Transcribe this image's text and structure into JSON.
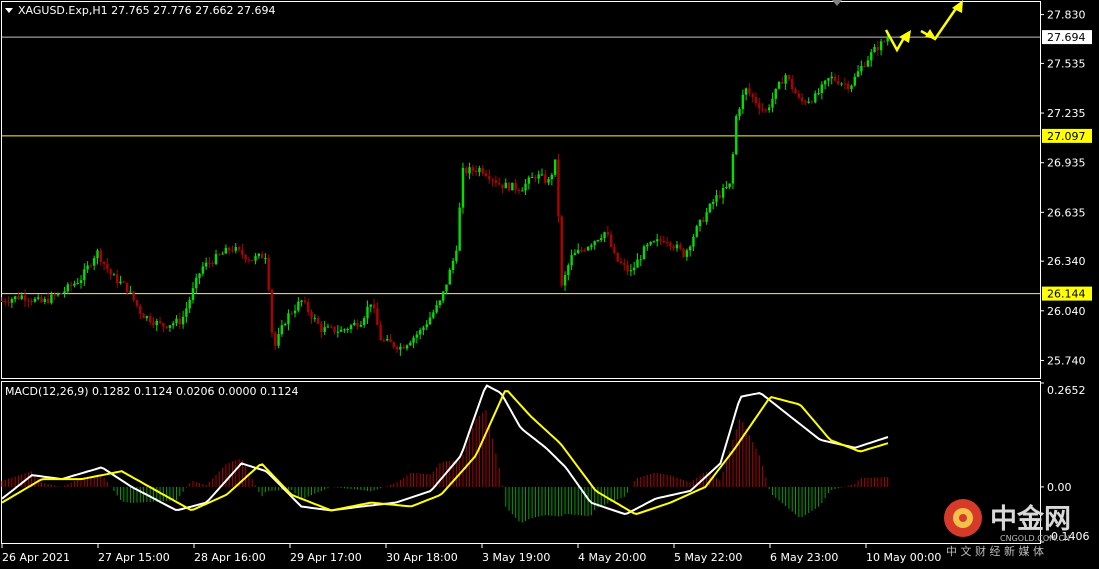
{
  "colors": {
    "background": "#000000",
    "bull": "#00e000",
    "bear": "#b00000",
    "level_line": "#ffff00",
    "last_price_line": "#c0c0c0",
    "macd_line": "#ffffff",
    "signal_line": "#ffff00",
    "hist_pos": "#b00000",
    "hist_neg": "#00a000",
    "arrow": "#ffff00",
    "frame": "#ffffff",
    "watermark_red": "#d83a2a"
  },
  "price_header": "XAGUSD.Exp,H1  27.765 27.776 27.662 27.694",
  "macd_header": "MACD(12,26,9) 0.1282 0.1124 0.0206 0.0000 0.1124",
  "price_ticks": [
    "27.830",
    "27.535",
    "27.235",
    "26.935",
    "26.635",
    "26.340",
    "26.040",
    "25.740"
  ],
  "macd_ticks": [
    "0.2652",
    "0.00",
    "-0.1406"
  ],
  "time_ticks": [
    "26 Apr 2021",
    "27 Apr 15:00",
    "28 Apr 16:00",
    "29 Apr 17:00",
    "30 Apr 18:00",
    "3 May 19:00",
    "4 May 20:00",
    "5 May 22:00",
    "6 May 23:00",
    "10 May 00:00"
  ],
  "levels": [
    {
      "value": 27.694,
      "label": "27.694",
      "kind": "last"
    },
    {
      "value": 27.097,
      "label": "27.097",
      "kind": "level"
    },
    {
      "value": 26.144,
      "label": "26.144",
      "kind": "level"
    }
  ],
  "watermark": {
    "brand": "中金网",
    "site": "CNGOLD.COM.CN",
    "tagline": "中 文 财 经 新 媒 体"
  },
  "chart_data": {
    "type": "candlestick",
    "symbol": "XAGUSD.Exp",
    "timeframe": "H1",
    "ohlc": {
      "open": 27.765,
      "high": 27.776,
      "low": 27.662,
      "close": 27.694
    },
    "ylim": [
      25.64,
      27.9
    ],
    "close_path": [
      {
        "x": 0,
        "y": 26.1
      },
      {
        "x": 20,
        "y": 26.13
      },
      {
        "x": 40,
        "y": 26.09
      },
      {
        "x": 60,
        "y": 26.15
      },
      {
        "x": 80,
        "y": 26.24
      },
      {
        "x": 95,
        "y": 26.4
      },
      {
        "x": 110,
        "y": 26.25
      },
      {
        "x": 125,
        "y": 26.18
      },
      {
        "x": 140,
        "y": 26.02
      },
      {
        "x": 160,
        "y": 25.95
      },
      {
        "x": 180,
        "y": 25.98
      },
      {
        "x": 200,
        "y": 26.3
      },
      {
        "x": 215,
        "y": 26.36
      },
      {
        "x": 230,
        "y": 26.42
      },
      {
        "x": 250,
        "y": 26.35
      },
      {
        "x": 265,
        "y": 26.38
      },
      {
        "x": 272,
        "y": 25.8
      },
      {
        "x": 285,
        "y": 26.0
      },
      {
        "x": 300,
        "y": 26.1
      },
      {
        "x": 320,
        "y": 25.93
      },
      {
        "x": 340,
        "y": 25.92
      },
      {
        "x": 360,
        "y": 25.98
      },
      {
        "x": 370,
        "y": 26.1
      },
      {
        "x": 380,
        "y": 25.86
      },
      {
        "x": 400,
        "y": 25.82
      },
      {
        "x": 420,
        "y": 25.92
      },
      {
        "x": 440,
        "y": 26.1
      },
      {
        "x": 455,
        "y": 26.4
      },
      {
        "x": 462,
        "y": 26.88
      },
      {
        "x": 480,
        "y": 26.9
      },
      {
        "x": 500,
        "y": 26.8
      },
      {
        "x": 520,
        "y": 26.78
      },
      {
        "x": 535,
        "y": 26.86
      },
      {
        "x": 548,
        "y": 26.82
      },
      {
        "x": 556,
        "y": 26.96
      },
      {
        "x": 560,
        "y": 26.16
      },
      {
        "x": 570,
        "y": 26.36
      },
      {
        "x": 590,
        "y": 26.45
      },
      {
        "x": 605,
        "y": 26.52
      },
      {
        "x": 615,
        "y": 26.35
      },
      {
        "x": 630,
        "y": 26.27
      },
      {
        "x": 645,
        "y": 26.42
      },
      {
        "x": 665,
        "y": 26.48
      },
      {
        "x": 684,
        "y": 26.38
      },
      {
        "x": 695,
        "y": 26.52
      },
      {
        "x": 715,
        "y": 26.72
      },
      {
        "x": 730,
        "y": 26.8
      },
      {
        "x": 736,
        "y": 27.22
      },
      {
        "x": 745,
        "y": 27.38
      },
      {
        "x": 765,
        "y": 27.24
      },
      {
        "x": 785,
        "y": 27.47
      },
      {
        "x": 800,
        "y": 27.3
      },
      {
        "x": 815,
        "y": 27.33
      },
      {
        "x": 830,
        "y": 27.45
      },
      {
        "x": 850,
        "y": 27.4
      },
      {
        "x": 862,
        "y": 27.52
      },
      {
        "x": 875,
        "y": 27.62
      },
      {
        "x": 889,
        "y": 27.694
      }
    ],
    "macd": {
      "params": "12,26,9",
      "values": [
        0.1282,
        0.1124,
        0.0206,
        0.0,
        0.1124
      ],
      "ylim": [
        -0.1406,
        0.2652
      ],
      "main_path": [
        {
          "x": 0,
          "y": -0.03
        },
        {
          "x": 30,
          "y": 0.03
        },
        {
          "x": 60,
          "y": 0.02
        },
        {
          "x": 100,
          "y": 0.05
        },
        {
          "x": 130,
          "y": 0.0
        },
        {
          "x": 175,
          "y": -0.06
        },
        {
          "x": 205,
          "y": -0.04
        },
        {
          "x": 240,
          "y": 0.06
        },
        {
          "x": 265,
          "y": 0.04
        },
        {
          "x": 300,
          "y": -0.05
        },
        {
          "x": 330,
          "y": -0.06
        },
        {
          "x": 360,
          "y": -0.05
        },
        {
          "x": 395,
          "y": -0.04
        },
        {
          "x": 430,
          "y": -0.01
        },
        {
          "x": 460,
          "y": 0.08
        },
        {
          "x": 485,
          "y": 0.26
        },
        {
          "x": 500,
          "y": 0.24
        },
        {
          "x": 520,
          "y": 0.15
        },
        {
          "x": 545,
          "y": 0.1
        },
        {
          "x": 565,
          "y": 0.05
        },
        {
          "x": 590,
          "y": -0.04
        },
        {
          "x": 625,
          "y": -0.07
        },
        {
          "x": 655,
          "y": -0.03
        },
        {
          "x": 690,
          "y": -0.01
        },
        {
          "x": 720,
          "y": 0.06
        },
        {
          "x": 740,
          "y": 0.23
        },
        {
          "x": 760,
          "y": 0.24
        },
        {
          "x": 790,
          "y": 0.18
        },
        {
          "x": 820,
          "y": 0.12
        },
        {
          "x": 855,
          "y": 0.1
        },
        {
          "x": 889,
          "y": 0.1282
        }
      ],
      "signal_path": [
        {
          "x": 0,
          "y": -0.04
        },
        {
          "x": 40,
          "y": 0.02
        },
        {
          "x": 80,
          "y": 0.02
        },
        {
          "x": 120,
          "y": 0.04
        },
        {
          "x": 155,
          "y": -0.01
        },
        {
          "x": 190,
          "y": -0.06
        },
        {
          "x": 225,
          "y": -0.02
        },
        {
          "x": 260,
          "y": 0.06
        },
        {
          "x": 290,
          "y": -0.02
        },
        {
          "x": 330,
          "y": -0.06
        },
        {
          "x": 370,
          "y": -0.04
        },
        {
          "x": 410,
          "y": -0.05
        },
        {
          "x": 440,
          "y": -0.02
        },
        {
          "x": 475,
          "y": 0.08
        },
        {
          "x": 505,
          "y": 0.25
        },
        {
          "x": 530,
          "y": 0.18
        },
        {
          "x": 560,
          "y": 0.11
        },
        {
          "x": 595,
          "y": -0.01
        },
        {
          "x": 635,
          "y": -0.07
        },
        {
          "x": 670,
          "y": -0.04
        },
        {
          "x": 705,
          "y": 0.0
        },
        {
          "x": 735,
          "y": 0.1
        },
        {
          "x": 770,
          "y": 0.23
        },
        {
          "x": 800,
          "y": 0.21
        },
        {
          "x": 830,
          "y": 0.12
        },
        {
          "x": 860,
          "y": 0.09
        },
        {
          "x": 889,
          "y": 0.1124
        }
      ]
    }
  }
}
